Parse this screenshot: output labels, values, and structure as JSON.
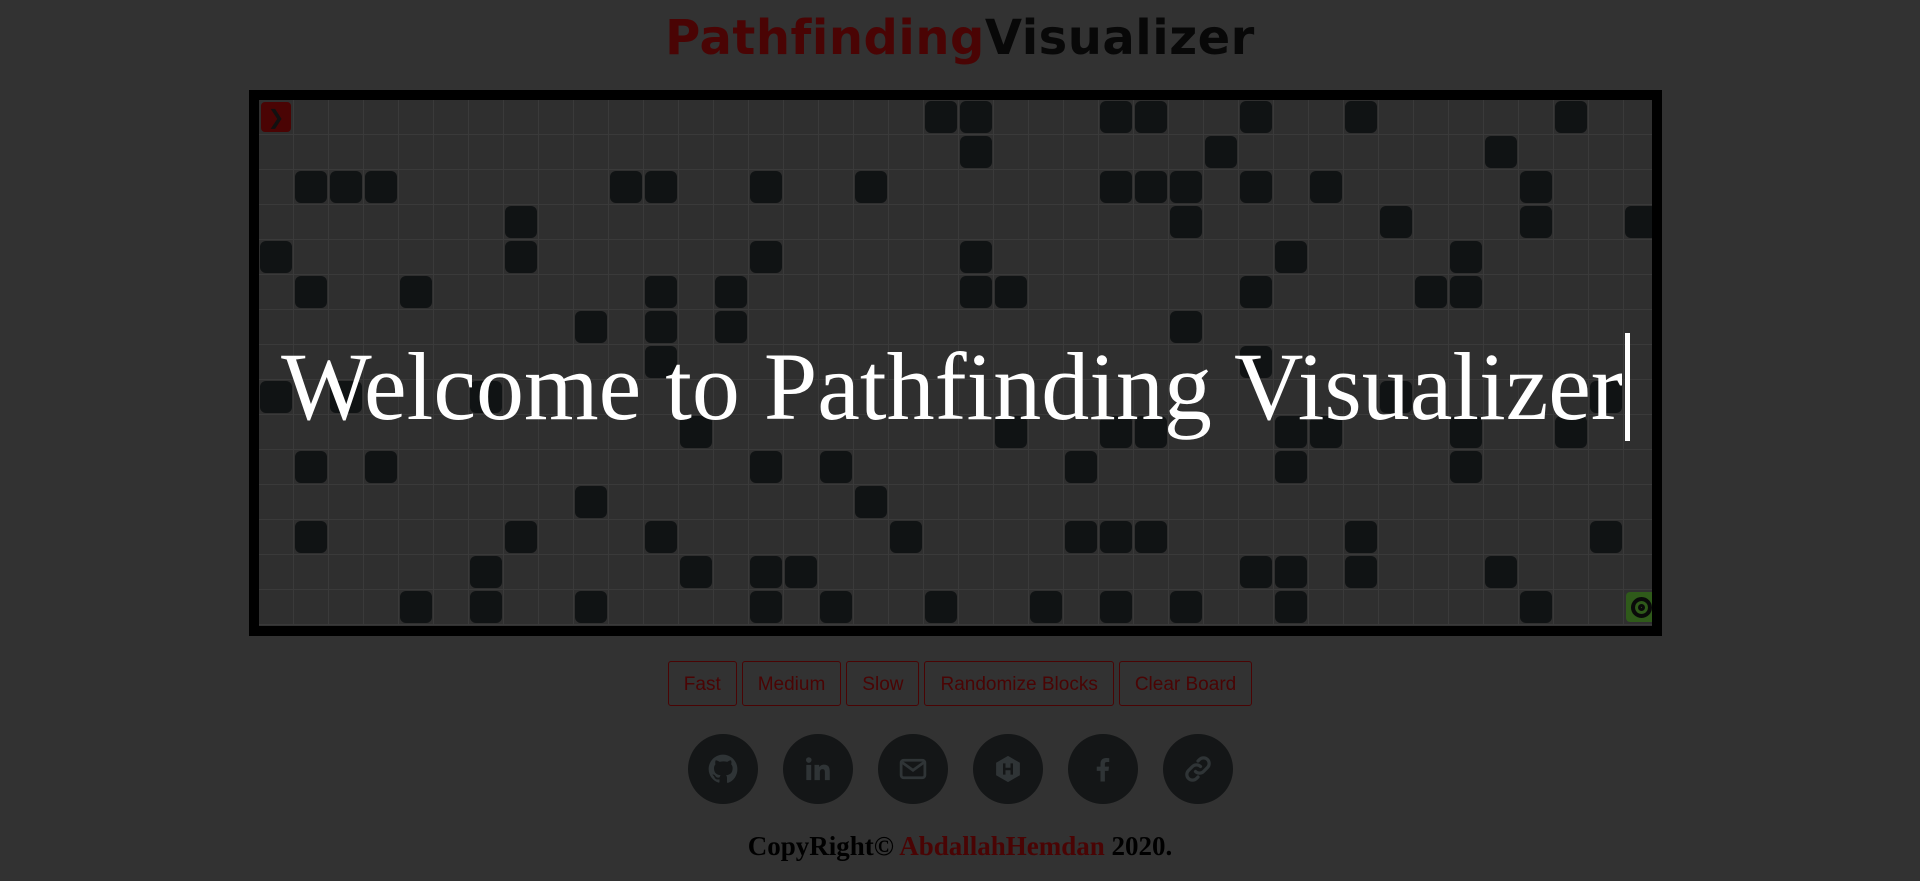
{
  "header": {
    "title_part1": "Pathfinding",
    "title_part2": "Visualizer"
  },
  "overlay": {
    "welcome_text": "Welcome to Pathfinding Visualizer"
  },
  "board": {
    "rows": 15,
    "cols": 40,
    "start": [
      0,
      0
    ],
    "end": [
      14,
      39
    ],
    "walls": [
      [
        0,
        19
      ],
      [
        0,
        20
      ],
      [
        0,
        24
      ],
      [
        0,
        25
      ],
      [
        0,
        28
      ],
      [
        0,
        31
      ],
      [
        0,
        37
      ],
      [
        1,
        20
      ],
      [
        1,
        27
      ],
      [
        1,
        35
      ],
      [
        2,
        1
      ],
      [
        2,
        2
      ],
      [
        2,
        3
      ],
      [
        2,
        10
      ],
      [
        2,
        11
      ],
      [
        2,
        14
      ],
      [
        2,
        17
      ],
      [
        2,
        24
      ],
      [
        2,
        25
      ],
      [
        2,
        26
      ],
      [
        2,
        28
      ],
      [
        2,
        30
      ],
      [
        2,
        36
      ],
      [
        3,
        7
      ],
      [
        3,
        26
      ],
      [
        3,
        32
      ],
      [
        3,
        36
      ],
      [
        3,
        39
      ],
      [
        4,
        0
      ],
      [
        4,
        7
      ],
      [
        4,
        14
      ],
      [
        4,
        20
      ],
      [
        4,
        29
      ],
      [
        4,
        34
      ],
      [
        5,
        1
      ],
      [
        5,
        4
      ],
      [
        5,
        11
      ],
      [
        5,
        13
      ],
      [
        5,
        20
      ],
      [
        5,
        21
      ],
      [
        5,
        28
      ],
      [
        5,
        33
      ],
      [
        5,
        34
      ],
      [
        6,
        9
      ],
      [
        6,
        11
      ],
      [
        6,
        13
      ],
      [
        6,
        26
      ],
      [
        7,
        11
      ],
      [
        7,
        28
      ],
      [
        8,
        0
      ],
      [
        8,
        2
      ],
      [
        8,
        6
      ],
      [
        8,
        32
      ],
      [
        8,
        38
      ],
      [
        9,
        12
      ],
      [
        9,
        21
      ],
      [
        9,
        24
      ],
      [
        9,
        25
      ],
      [
        9,
        29
      ],
      [
        9,
        30
      ],
      [
        9,
        34
      ],
      [
        9,
        37
      ],
      [
        10,
        1
      ],
      [
        10,
        3
      ],
      [
        10,
        14
      ],
      [
        10,
        16
      ],
      [
        10,
        23
      ],
      [
        10,
        29
      ],
      [
        10,
        34
      ],
      [
        11,
        9
      ],
      [
        11,
        17
      ],
      [
        12,
        1
      ],
      [
        12,
        7
      ],
      [
        12,
        11
      ],
      [
        12,
        18
      ],
      [
        12,
        23
      ],
      [
        12,
        24
      ],
      [
        12,
        25
      ],
      [
        12,
        31
      ],
      [
        12,
        38
      ],
      [
        13,
        6
      ],
      [
        13,
        12
      ],
      [
        13,
        14
      ],
      [
        13,
        15
      ],
      [
        13,
        28
      ],
      [
        13,
        29
      ],
      [
        13,
        31
      ],
      [
        13,
        35
      ],
      [
        14,
        4
      ],
      [
        14,
        6
      ],
      [
        14,
        9
      ],
      [
        14,
        14
      ],
      [
        14,
        16
      ],
      [
        14,
        19
      ],
      [
        14,
        22
      ],
      [
        14,
        24
      ],
      [
        14,
        26
      ],
      [
        14,
        29
      ],
      [
        14,
        36
      ]
    ]
  },
  "controls": {
    "fast": "Fast",
    "medium": "Medium",
    "slow": "Slow",
    "randomize": "Randomize Blocks",
    "clear": "Clear Board"
  },
  "socials": [
    {
      "icon": "github-icon"
    },
    {
      "icon": "linkedin-icon"
    },
    {
      "icon": "mail-icon"
    },
    {
      "icon": "hackerrank-icon"
    },
    {
      "icon": "facebook-icon"
    },
    {
      "icon": "link-icon"
    }
  ],
  "footer": {
    "prefix": "CopyRight©",
    "author": "AbdallahHemdan",
    "year": "2020."
  },
  "colors": {
    "background": "#323232",
    "accent": "#4a0404",
    "wall": "#101314",
    "end": "#2f5a1a",
    "icon_circle": "#141617"
  }
}
